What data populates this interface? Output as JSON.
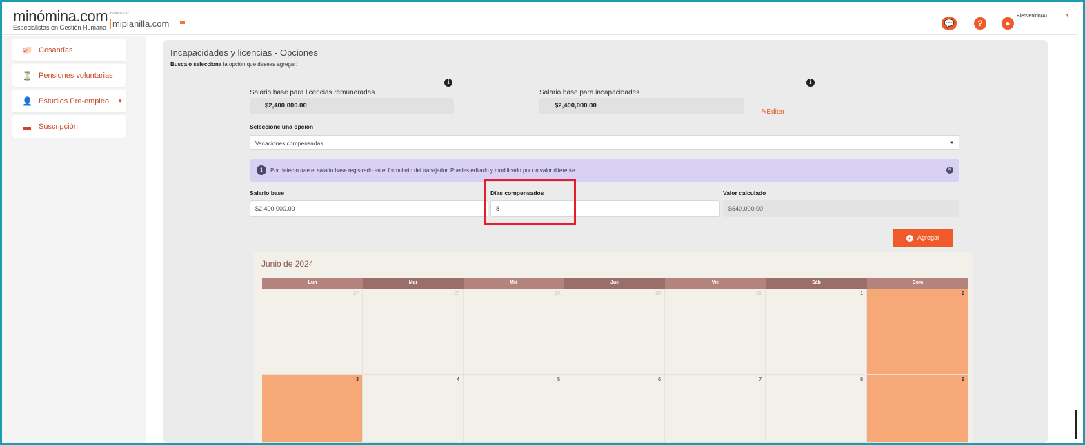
{
  "header": {
    "logo_main": "minómina.com",
    "logo_sub": "Especialistas en Gestión Humana",
    "powered_by": "POWERED BY",
    "partner": "miplanilla.com",
    "welcome": "Bienvenido(A)"
  },
  "sidebar": {
    "items": [
      {
        "label": "Cesantías",
        "icon": "piggy-bank-icon"
      },
      {
        "label": "Pensiones voluntarias",
        "icon": "hourglass-icon"
      },
      {
        "label": "Estudios Pre-empleo",
        "icon": "user-plus-icon"
      },
      {
        "label": "Suscripción",
        "icon": "card-icon"
      }
    ]
  },
  "main": {
    "title": "Incapacidades y licencias - Opciones",
    "subtitle_bold": "Busca o selecciona",
    "subtitle_rest": " la opción que deseas agregar:",
    "salary_licenses_label": "Salario base para licencias remuneradas",
    "salary_licenses_value": "$2,400,000.00",
    "salary_incap_label": "Salario base para incapacidades",
    "salary_incap_value": "$2,400,000.00",
    "edit_label": "Editar",
    "select_label": "Seleccione una opción",
    "select_value": "Vacaciones compensadas",
    "alert_text": "Por defecto trae el salario base registrado en el formulario del trabajador. Puedes editarlo y modificarlo por un valor diferente.",
    "base_salary_label": "Salario base",
    "base_salary_value": "$2,400,000.00",
    "days_label": "Días compensados",
    "days_value": "8",
    "calc_label": "Valor calculado",
    "calc_value": "$640,000.00",
    "add_button": "Agregar"
  },
  "calendar": {
    "title": "Junio de 2024",
    "days": [
      "Lun",
      "Mar",
      "Mié",
      "Jue",
      "Vie",
      "Sáb",
      "Dom"
    ],
    "week1": [
      "27",
      "28",
      "29",
      "30",
      "31",
      "1",
      "2"
    ],
    "week2": [
      "3",
      "4",
      "5",
      "6",
      "7",
      "8",
      "9"
    ],
    "colors": {
      "header_light": "#b5837d",
      "header_dark": "#9b6f69",
      "holiday": "#f6a877"
    }
  },
  "colors": {
    "accent": "#f05a2a",
    "border": "#1a9db0",
    "alert_bg": "#d9d0f6"
  }
}
